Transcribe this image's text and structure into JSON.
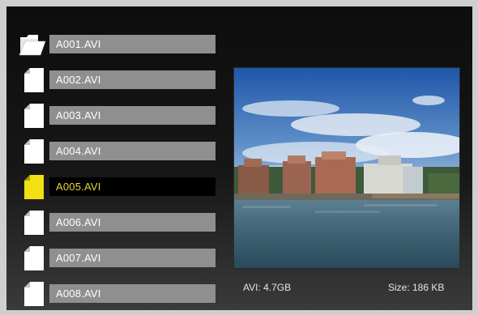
{
  "file_list": {
    "items": [
      {
        "name": "A001.AVI",
        "icon": "folder-open-icon",
        "selected": false
      },
      {
        "name": "A002.AVI",
        "icon": "file-icon",
        "selected": false
      },
      {
        "name": "A003.AVI",
        "icon": "file-icon",
        "selected": false
      },
      {
        "name": "A004.AVI",
        "icon": "file-icon",
        "selected": false
      },
      {
        "name": "A005.AVI",
        "icon": "file-icon",
        "selected": true
      },
      {
        "name": "A006.AVI",
        "icon": "file-icon",
        "selected": false
      },
      {
        "name": "A007.AVI",
        "icon": "file-icon",
        "selected": false
      },
      {
        "name": "A008.AVI",
        "icon": "file-icon",
        "selected": false
      }
    ]
  },
  "info": {
    "type_size": "AVI: 4.7GB",
    "file_size": "Size: 186 KB"
  },
  "colors": {
    "selected_text": "#e6d63a",
    "selected_icon": "#f2df14",
    "label_bg": "#8f8f8f"
  }
}
